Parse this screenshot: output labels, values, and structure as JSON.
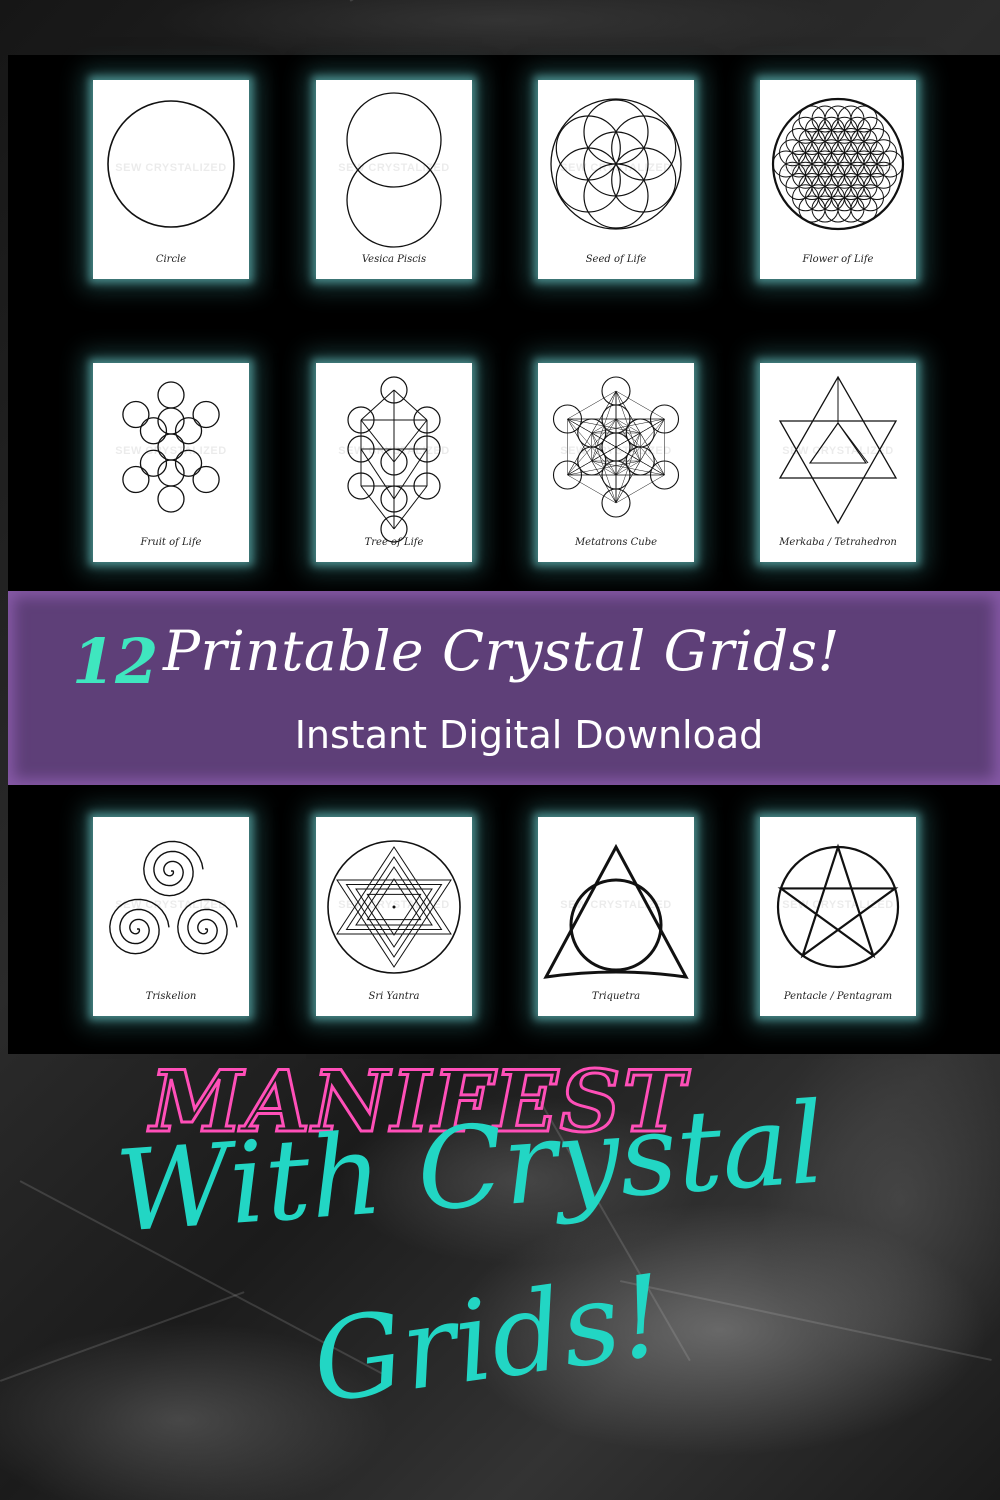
{
  "watermark": "SEW CRYSTALIZED",
  "cards": [
    {
      "label": "Circle",
      "icon": "circle-icon"
    },
    {
      "label": "Vesica Piscis",
      "icon": "vesica-piscis-icon"
    },
    {
      "label": "Seed of Life",
      "icon": "seed-of-life-icon"
    },
    {
      "label": "Flower of Life",
      "icon": "flower-of-life-icon"
    },
    {
      "label": "Fruit of Life",
      "icon": "fruit-of-life-icon"
    },
    {
      "label": "Tree of Life",
      "icon": "tree-of-life-icon"
    },
    {
      "label": "Metatrons Cube",
      "icon": "metatrons-cube-icon"
    },
    {
      "label": "Merkaba / Tetrahedron",
      "icon": "merkaba-icon"
    },
    {
      "label": "Triskelion",
      "icon": "triskelion-icon"
    },
    {
      "label": "Sri Yantra",
      "icon": "sri-yantra-icon"
    },
    {
      "label": "Triquetra",
      "icon": "triquetra-icon"
    },
    {
      "label": "Pentacle / Pentagram",
      "icon": "pentagram-icon"
    }
  ],
  "banner": {
    "count": "12",
    "title": "Printable Crystal Grids!",
    "subtitle": "Instant Digital Download"
  },
  "tagline": {
    "line1": "MANIFEST",
    "line2": "With Crystal",
    "line3": "Grids!"
  },
  "colors": {
    "banner_purple": "#5e3f78",
    "count_teal": "#3fe6bf",
    "manifest_pink": "#ff4fb8",
    "script_teal": "#22d6c4",
    "card_glow": "#50a0a0"
  }
}
